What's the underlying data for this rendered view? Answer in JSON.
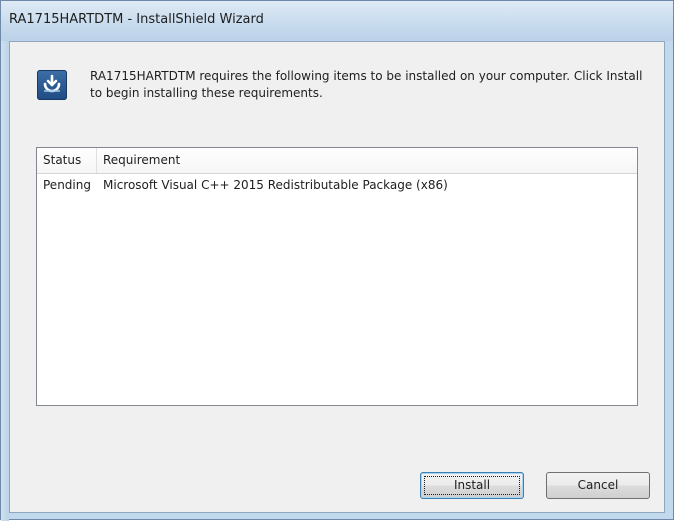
{
  "window": {
    "title": "RA1715HARTDTM - InstallShield Wizard"
  },
  "message": {
    "icon": "installshield-info-icon",
    "text": "RA1715HARTDTM requires the following items to be installed on your computer. Click Install to begin installing these requirements."
  },
  "requirements_list": {
    "columns": [
      "Status",
      "Requirement"
    ],
    "rows": [
      {
        "status": "Pending",
        "requirement": "Microsoft Visual C++ 2015 Redistributable Package (x86)"
      }
    ]
  },
  "buttons": {
    "install_label": "Install",
    "cancel_label": "Cancel"
  }
}
